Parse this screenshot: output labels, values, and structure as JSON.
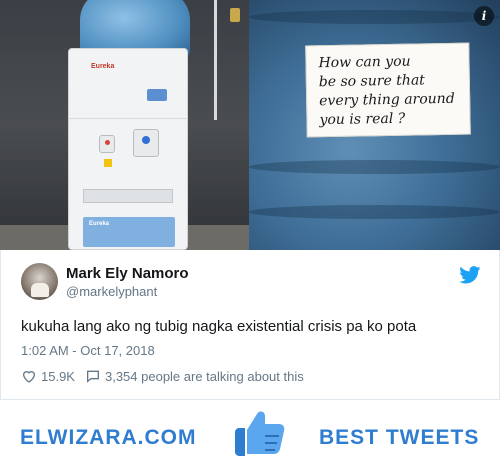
{
  "photos": {
    "left": {
      "brand": "Eureka",
      "sticker": "Eureka"
    },
    "right": {
      "note_lines": [
        "How can you",
        "be so sure that",
        "every thing around",
        "you is real ?"
      ]
    },
    "info_icon": "info-icon"
  },
  "tweet": {
    "author_name": "Mark Ely Namoro",
    "author_handle": "@markelyphant",
    "text": "kukuha lang ako ng tubig nagka existential crisis pa ko pota",
    "timestamp": "1:02 AM - Oct 17, 2018",
    "likes": "15.9K",
    "talking": "3,354 people are talking about this",
    "brand_icon": "twitter-bird-icon"
  },
  "banner": {
    "left_text": "ELWIZARA.COM",
    "right_text": "BEST TWEETS",
    "icon": "thumbs-up-icon"
  },
  "colors": {
    "brand_blue": "#2f7dd0",
    "twitter_blue": "#1da1f2",
    "muted_text": "#657786"
  }
}
